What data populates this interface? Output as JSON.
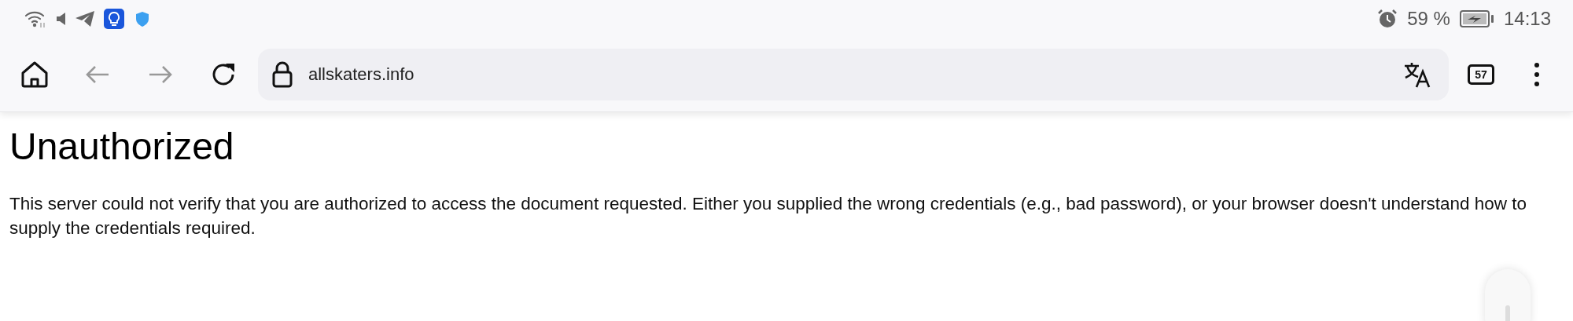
{
  "status_bar": {
    "battery_percent": "59 %",
    "time": "14:13"
  },
  "toolbar": {
    "url": "allskaters.info",
    "tab_count": "57",
    "back_disabled": true,
    "forward_disabled": true
  },
  "page": {
    "heading": "Unauthorized",
    "message": "This server could not verify that you are authorized to access the document requested. Either you supplied the wrong credentials (e.g., bad password), or your browser doesn't understand how to supply the credentials required."
  }
}
